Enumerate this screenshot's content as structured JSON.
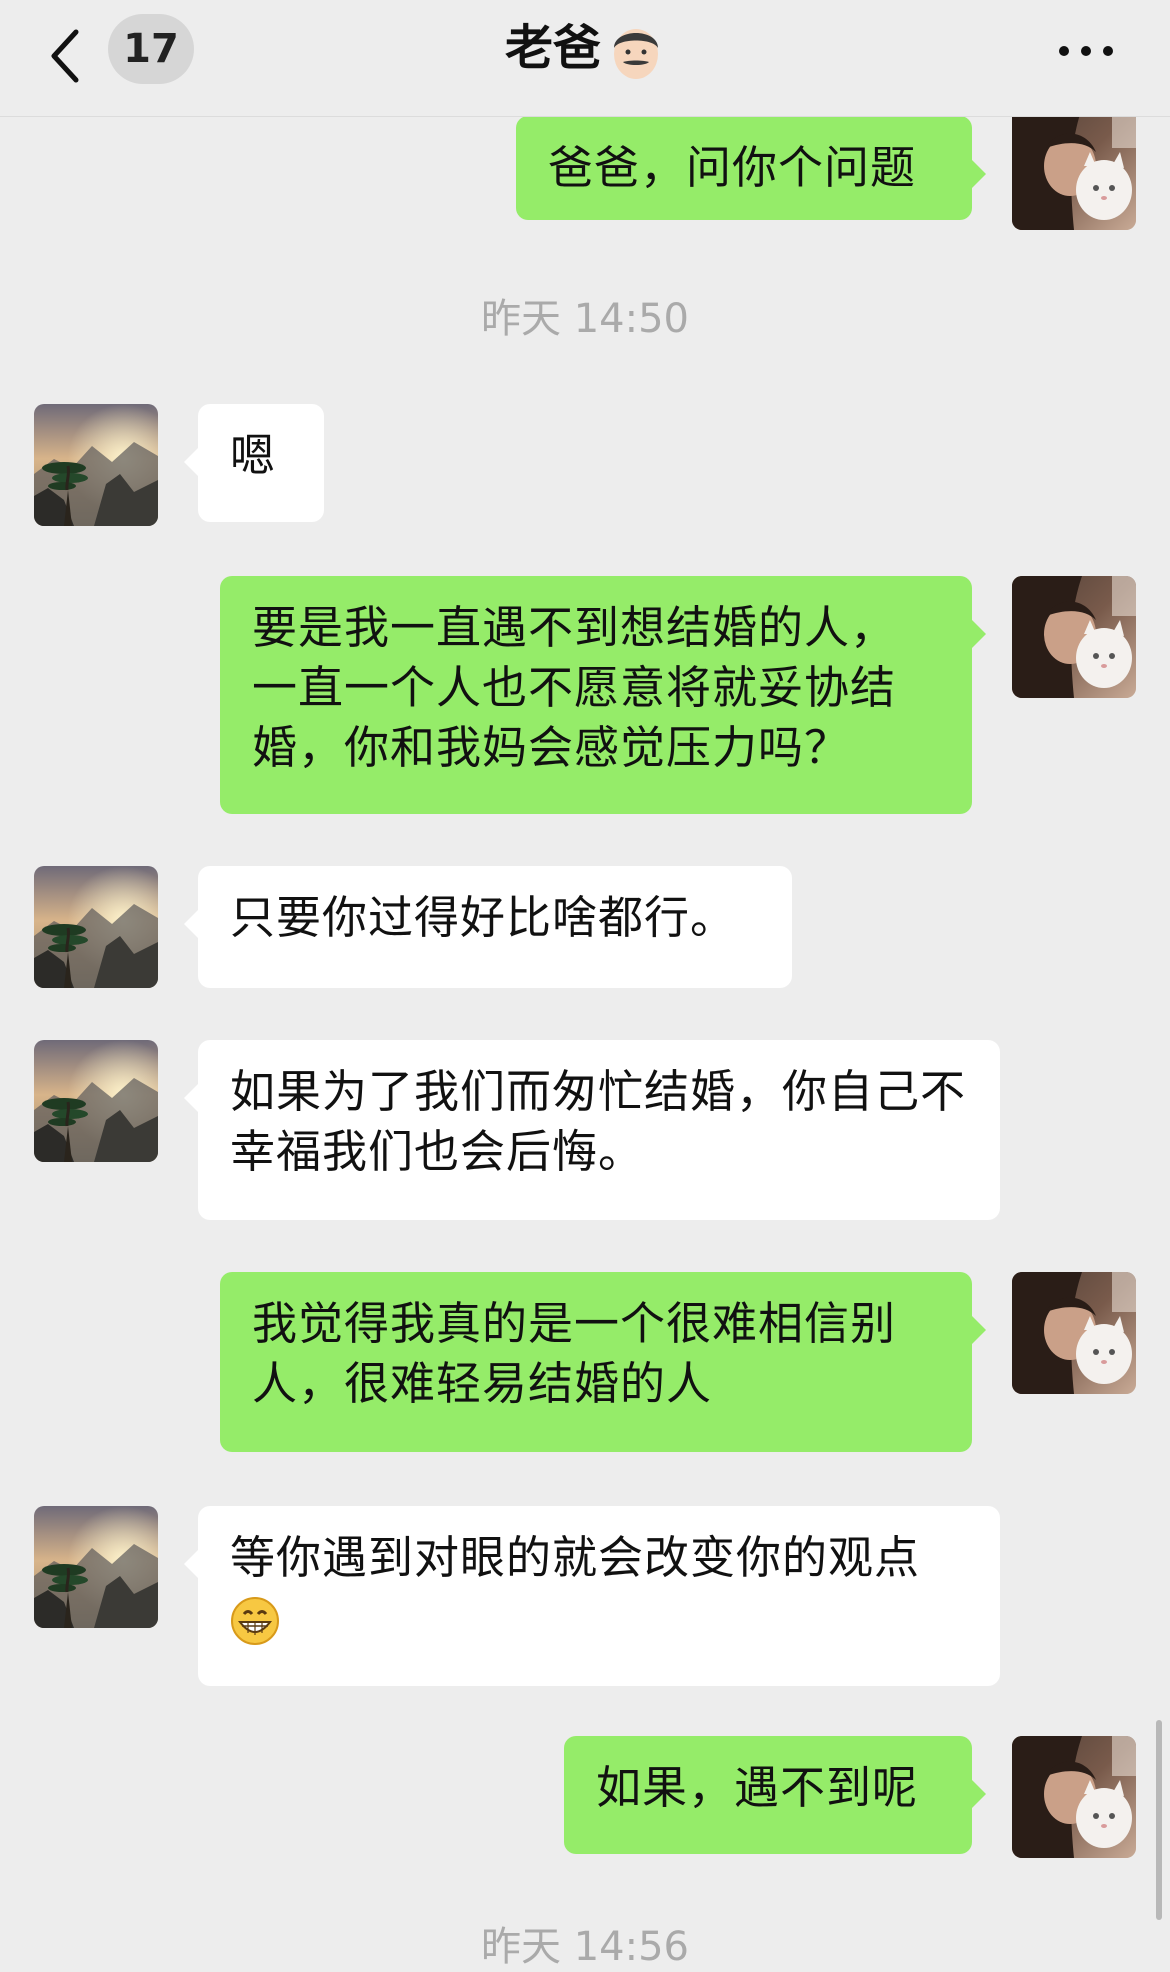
{
  "header": {
    "unread_count": "17",
    "title": "老爸",
    "title_emoji": "man-emoji"
  },
  "messages": [
    {
      "from": "me",
      "text": "爸爸，问你个问题"
    },
    {
      "type": "time",
      "text": "昨天 14:50"
    },
    {
      "from": "dad",
      "text": "嗯"
    },
    {
      "from": "me",
      "text": "要是我一直遇不到想结婚的人，一直一个人也不愿意将就妥协结婚，你和我妈会感觉压力吗？"
    },
    {
      "from": "dad",
      "text": "只要你过得好比啥都行。"
    },
    {
      "from": "dad",
      "text": "如果为了我们而匆忙结婚，你自己不幸福我们也会后悔。"
    },
    {
      "from": "me",
      "text": "我觉得我真的是一个很难相信别人，很难轻易结婚的人"
    },
    {
      "from": "dad",
      "text": "等你遇到对眼的就会改变你的观点",
      "emoji": "grinning-face-emoji"
    },
    {
      "from": "me",
      "text": "如果，遇不到呢"
    },
    {
      "type": "time",
      "text": "昨天 14:56"
    }
  ],
  "avatars": {
    "dad": "mountain-pine-landscape",
    "me": "woman-with-white-cat"
  },
  "colors": {
    "background": "#ededed",
    "outgoing_bubble": "#95ec69",
    "incoming_bubble": "#ffffff"
  }
}
